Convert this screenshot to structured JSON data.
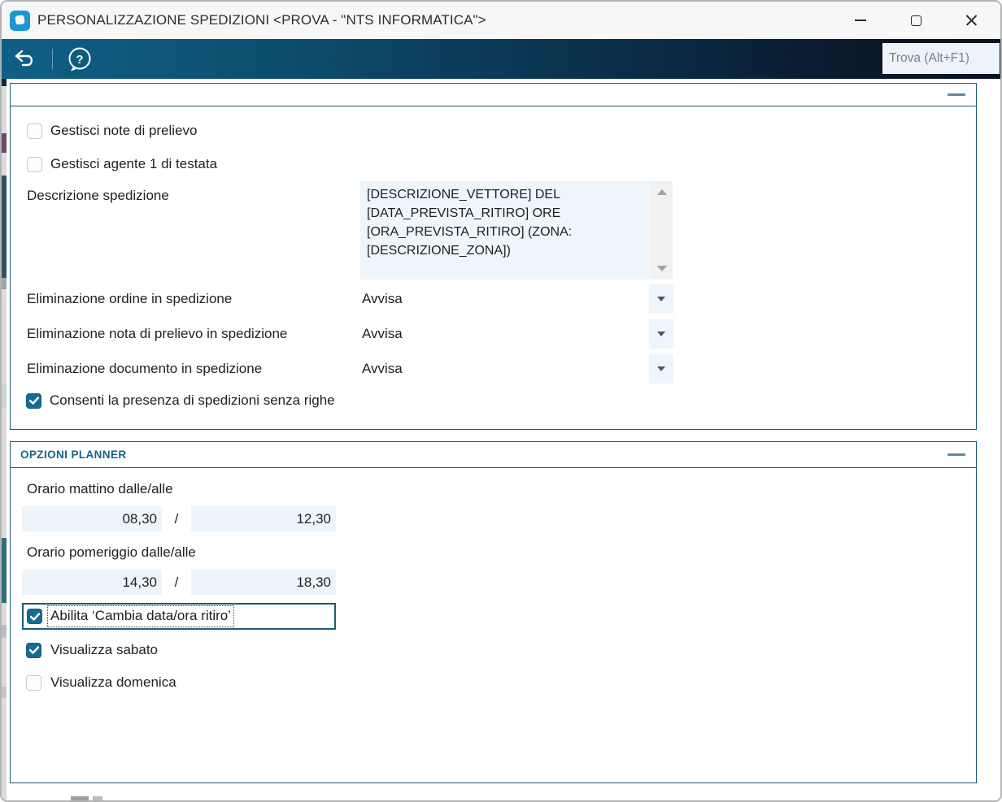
{
  "titlebar": {
    "title": "PERSONALIZZAZIONE SPEDIZIONI <PROVA - \"NTS INFORMATICA\">"
  },
  "toolbar": {
    "help_glyph": "?",
    "find_placeholder": "Trova (Alt+F1)"
  },
  "colors": {
    "panel_border": "#1d5d79",
    "checkbox_checked": "#176b90",
    "section_title": "#15648c",
    "ribbon_left": "#0f6086",
    "ribbon_right": "#091322",
    "field_bg": "#edf5fb",
    "app_icon_blue": "#1a96d4"
  },
  "section_general": {
    "checkbox_note": {
      "label": "Gestisci note di prelievo",
      "checked": false
    },
    "checkbox_agente": {
      "label": "Gestisci agente 1 di testata",
      "checked": false
    },
    "descrizione": {
      "label": "Descrizione spedizione",
      "value": "[DESCRIZIONE_VETTORE] DEL [DATA_PREVISTA_RITIRO] ORE [ORA_PREVISTA_RITIRO] (ZONA: [DESCRIZIONE_ZONA])"
    },
    "eliminazione_ordine": {
      "label": "Eliminazione ordine in spedizione",
      "value": "Avvisa"
    },
    "eliminazione_nota": {
      "label": "Eliminazione nota di prelievo in spedizione",
      "value": "Avvisa"
    },
    "eliminazione_documento": {
      "label": "Eliminazione documento in spedizione",
      "value": "Avvisa"
    },
    "checkbox_senza_righe": {
      "label": "Consenti la presenza di spedizioni senza righe",
      "checked": true
    }
  },
  "section_planner": {
    "title": "OPZIONI PLANNER",
    "mattino": {
      "label": "Orario mattino dalle/alle",
      "from": "08,30",
      "separator": "/",
      "to": "12,30"
    },
    "pomeriggio": {
      "label": "Orario pomeriggio dalle/alle",
      "from": "14,30",
      "separator": "/",
      "to": "18,30"
    },
    "checkbox_abilita": {
      "label": "Abilita ‘Cambia data/ora ritiro’",
      "checked": true
    },
    "checkbox_sabato": {
      "label": "Visualizza sabato",
      "checked": true
    },
    "checkbox_domenica": {
      "label": "Visualizza domenica",
      "checked": false
    }
  }
}
